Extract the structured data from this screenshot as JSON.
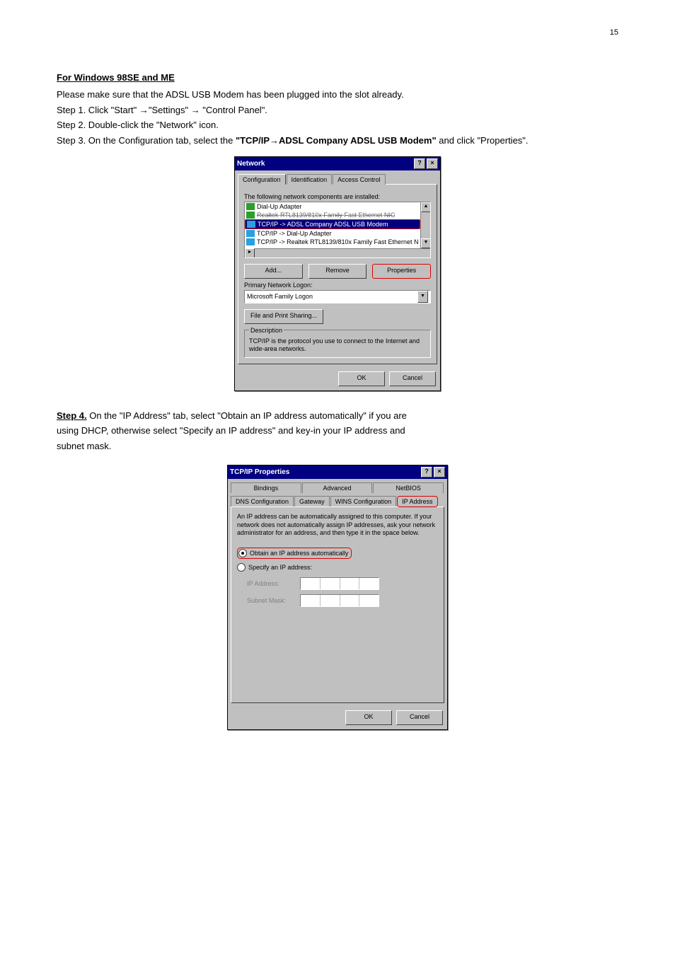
{
  "page": {
    "number": "15"
  },
  "section1": {
    "title": "For Windows 98SE and ME",
    "intro": "Please make sure that the ADSL USB Modem has been plugged into the slot already.",
    "step1": "Step 1. Click \"Start\" →\"Settings\" → \"Control Panel\".",
    "step2": "Step 2. Double-click the \"Network\" icon.",
    "step3_a": "Step 3. On the Configuration tab, select the",
    "step3_b": "\"TCP/IP→ADSL Company ADSL USB Modem\"",
    "step3_c": "and click \"Properties\"."
  },
  "dialog1": {
    "title": "Network",
    "tabs": [
      "Configuration",
      "Identification",
      "Access Control"
    ],
    "list_label": "The following network components are installed:",
    "items": [
      "Dial-Up Adapter",
      "Realtek RTL8139/810x Family Fast Ethernet NIC",
      "TCP/IP -> ADSL Company ADSL USB Modem",
      "TCP/IP -> Dial-Up Adapter",
      "TCP/IP -> Realtek RTL8139/810x Family Fast Ethernet N"
    ],
    "buttons": {
      "add": "Add...",
      "remove": "Remove",
      "properties": "Properties"
    },
    "primary_label": "Primary Network Logon:",
    "primary_value": "Microsoft Family Logon",
    "file_print": "File and Print Sharing...",
    "desc_label": "Description",
    "desc_text": "TCP/IP is the protocol you use to connect to the Internet and wide-area networks.",
    "ok": "OK",
    "cancel": "Cancel"
  },
  "section2": {
    "title": "Step 4.",
    "line1": " On the \"IP Address\" tab, select \"Obtain an IP address automatically\" if you are",
    "line2": "using DHCP, otherwise select \"Specify an IP address\" and key-in your IP address and",
    "line3": "subnet mask."
  },
  "dialog2": {
    "title": "TCP/IP Properties",
    "tabs_row1": [
      "Bindings",
      "Advanced",
      "NetBIOS"
    ],
    "tabs_row2": [
      "DNS Configuration",
      "Gateway",
      "WINS Configuration",
      "IP Address"
    ],
    "explain": "An IP address can be automatically assigned to this computer. If your network does not automatically assign IP addresses, ask your network administrator for an address, and then type it in the space below.",
    "radio_auto": "Obtain an IP address automatically",
    "radio_specify": "Specify an IP address:",
    "ip_label": "IP Address:",
    "mask_label": "Subnet Mask:",
    "ok": "OK",
    "cancel": "Cancel"
  }
}
